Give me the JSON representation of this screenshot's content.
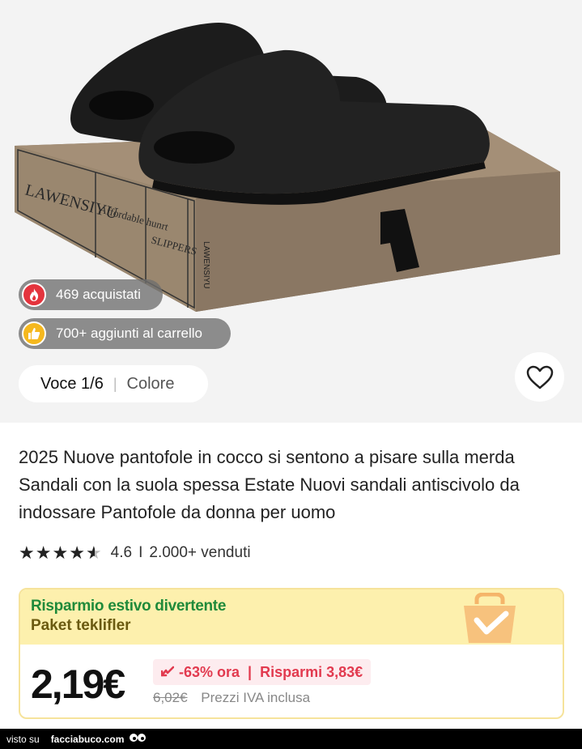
{
  "product_image": {
    "box_brand": "LAWENSIYU",
    "box_tag_1": "Affordable hunrt",
    "box_tag_2": "SLIPPERS",
    "box_side_text": "LAWENSIYU",
    "box_logo": "L"
  },
  "badges": {
    "bought_icon": "fire-icon",
    "bought_text": "469 acquistati",
    "cart_icon": "thumbs-up-icon",
    "cart_text": "700+ aggiunti al carrello"
  },
  "variant": {
    "item": "Voce 1/6",
    "separator": "|",
    "color_label": "Colore"
  },
  "favorite_icon": "heart-icon",
  "title": "2025 Nuove pantofole in cocco si sentono a pisare sulla merda Sandali con la suola spessa Estate Nuovi sandali antiscivolo da indossare Pantofole da donna per uomo",
  "rating": {
    "stars": 4.5,
    "score": "4.6",
    "separator": "I",
    "sold": "2.000+ venduti"
  },
  "promo": {
    "title": "Risparmio estivo divertente",
    "subtitle": "Paket teklifler",
    "price": "2,19€",
    "discount": "-63% ora",
    "discount_sep": "|",
    "savings": "Risparmi 3,83€",
    "original_price": "6,02€",
    "vat_note": "Prezzi IVA inclusa",
    "colors": {
      "title": "#1f8a3a",
      "discount": "#e23a4f",
      "header_bg": "#fdf0ad"
    }
  },
  "footer": {
    "prefix": "visto su",
    "site": "facciabuco.com"
  }
}
